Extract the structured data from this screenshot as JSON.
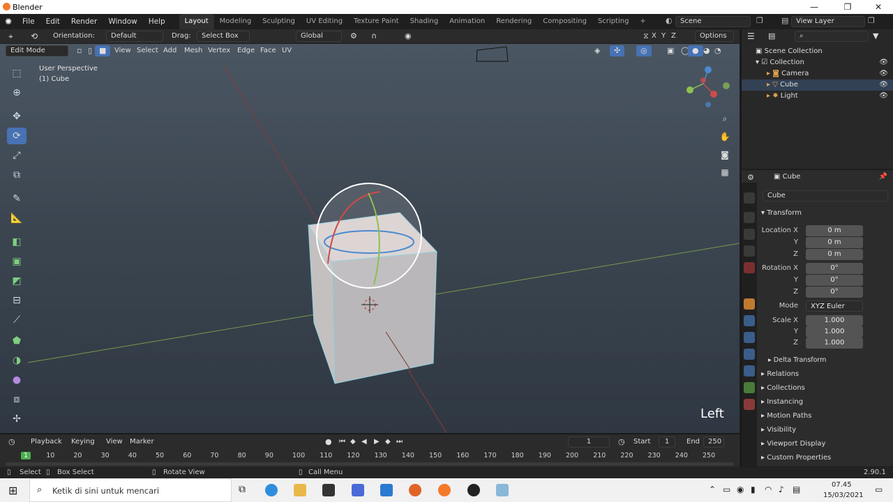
{
  "window": {
    "title": "Blender",
    "controls": [
      "—",
      "❐",
      "✕"
    ]
  },
  "menu": {
    "file": "File",
    "edit": "Edit",
    "render": "Render",
    "window": "Window",
    "help": "Help"
  },
  "workspaces": [
    "Layout",
    "Modeling",
    "Sculpting",
    "UV Editing",
    "Texture Paint",
    "Shading",
    "Animation",
    "Rendering",
    "Compositing",
    "Scripting"
  ],
  "workspace_add": "+",
  "scene": {
    "name": "Scene",
    "view_layer": "View Layer"
  },
  "toolbar": {
    "orientation_label": "Orientation:",
    "orientation_value": "Default",
    "drag_label": "Drag:",
    "drag_value": "Select Box",
    "transform_orientation": "Global",
    "axes": [
      "X",
      "Y",
      "Z"
    ],
    "options": "Options"
  },
  "header": {
    "mode": "Edit Mode",
    "view": "View",
    "select": "Select",
    "add": "Add",
    "mesh": "Mesh",
    "vertex": "Vertex",
    "edge": "Edge",
    "face": "Face",
    "uv": "UV"
  },
  "viewport": {
    "perspective": "User Perspective",
    "object": "(1) Cube",
    "view_name": "Left"
  },
  "outliner": {
    "search_placeholder": "",
    "items": [
      {
        "label": "Scene Collection"
      },
      {
        "label": "Collection"
      },
      {
        "label": "Camera"
      },
      {
        "label": "Cube"
      },
      {
        "label": "Light"
      }
    ]
  },
  "properties": {
    "object_name": "Cube",
    "object_field": "Cube",
    "transform": "Transform",
    "location_label": "Location X",
    "location": {
      "x": "0 m",
      "y": "0 m",
      "z": "0 m"
    },
    "rotation_label": "Rotation X",
    "rotation": {
      "x": "0°",
      "y": "0°",
      "z": "0°"
    },
    "mode_label": "Mode",
    "mode_value": "XYZ Euler",
    "scale_label": "Scale X",
    "scale": {
      "x": "1.000",
      "y": "1.000",
      "z": "1.000"
    },
    "axis_y": "Y",
    "axis_z": "Z",
    "delta_transform": "Delta Transform",
    "sections": [
      "Relations",
      "Collections",
      "Instancing",
      "Motion Paths",
      "Visibility",
      "Viewport Display",
      "Custom Properties"
    ]
  },
  "timeline": {
    "playback": "Playback",
    "keying": "Keying",
    "view": "View",
    "marker": "Marker",
    "current_frame": "1",
    "start_label": "Start",
    "start": "1",
    "end_label": "End",
    "end": "250",
    "ruler": [
      "1",
      "10",
      "20",
      "30",
      "40",
      "50",
      "60",
      "70",
      "80",
      "90",
      "100",
      "110",
      "120",
      "130",
      "140",
      "150",
      "160",
      "170",
      "180",
      "190",
      "200",
      "210",
      "220",
      "230",
      "240",
      "250"
    ]
  },
  "status": {
    "select": "Select",
    "box_select": "Box Select",
    "rotate_view": "Rotate View",
    "call_menu": "Call Menu",
    "version": "2.90.1"
  },
  "taskbar": {
    "search_placeholder": "Ketik di sini untuk mencari",
    "time": "07.45",
    "date": "15/03/2021"
  },
  "colors": {
    "accent": "#4772b3",
    "viewport_top": "#4a5662",
    "x_axis": "#d04a4a",
    "y_axis": "#8cc152",
    "z_axis": "#4a8ad0"
  }
}
